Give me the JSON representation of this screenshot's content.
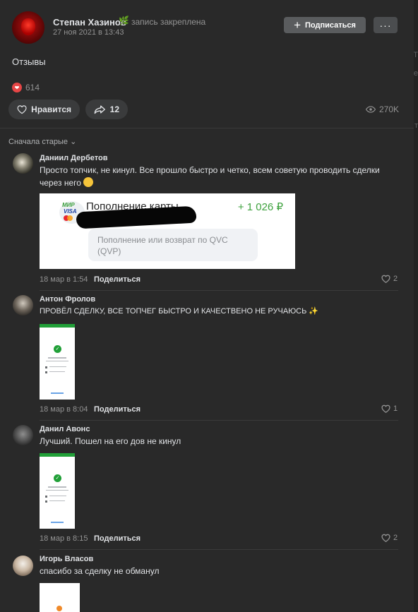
{
  "post": {
    "author": "Степан Хазинов",
    "pinned": "запись закреплена",
    "date": "27 ноя 2021 в 13:43",
    "subscribe": "Подписаться",
    "more": "···",
    "text": "Отзывы",
    "reactions_count": "614",
    "like_label": "Нравится",
    "share_count": "12",
    "views": "270K"
  },
  "comments_sort": "Сначала старые",
  "comments": [
    {
      "name": "Даниил Дербетов",
      "text": "Просто топчик, не кинул. Все прошло быстро и четко, всем советую проводить сделки через него",
      "time": "18 мар в 1:54",
      "share": "Поделиться",
      "likes": "2",
      "attachment": {
        "title": "Пополнение карты",
        "amount": "+ 1 026 ₽",
        "description": "Пополнение или возврат по QVC (QVP)",
        "logo_line1": "МИР",
        "logo_line2": "VISA"
      }
    },
    {
      "name": "Антон Фролов",
      "text": "ПРОВЁЛ СДЕЛКУ, ВСЕ ТОПЧЕГ БЫСТРО И КАЧЕСТВЕНО НЕ РУЧАЮСЬ",
      "time": "18 мар в 8:04",
      "share": "Поделиться",
      "likes": "1"
    },
    {
      "name": "Данил Авонс",
      "text": "Лучший. Пошел на его дов не кинул",
      "time": "18 мар в 8:15",
      "share": "Поделиться",
      "likes": "2"
    },
    {
      "name": "Игорь Власов",
      "text": "спасибо за сделку не обманул"
    }
  ],
  "colors": {
    "background": "#292929",
    "accent_green": "#3fa23f",
    "heart_red": "#e64646"
  }
}
